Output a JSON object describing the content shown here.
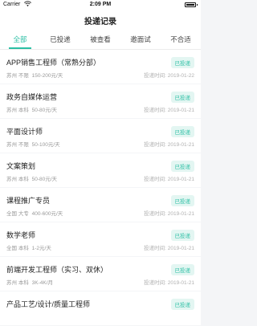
{
  "status_bar": {
    "carrier": "Carrier",
    "time": "2:09 PM"
  },
  "nav": {
    "title": "投递记录"
  },
  "tabs": [
    {
      "label": "全部"
    },
    {
      "label": "已投递"
    },
    {
      "label": "被查看"
    },
    {
      "label": "邀面试"
    },
    {
      "label": "不合适"
    }
  ],
  "active_tab": "全部",
  "accent_color": "#2bbfa4",
  "records": [
    {
      "title": "APP销售工程师（常熟分部）",
      "location": "苏州",
      "edu": "不限",
      "salary": "150-200元/天",
      "status": "已投递",
      "time": "投递时间: 2019-01-22"
    },
    {
      "title": "政务自媒体运营",
      "location": "苏州",
      "edu": "本科",
      "salary": "50-80元/天",
      "status": "已投递",
      "time": "投递时间: 2019-01-21"
    },
    {
      "title": "平面设计师",
      "location": "苏州",
      "edu": "不限",
      "salary": "50-100元/天",
      "status": "已投递",
      "time": "投递时间: 2019-01-21"
    },
    {
      "title": "文案策划",
      "location": "苏州",
      "edu": "本科",
      "salary": "50-80元/天",
      "status": "已投递",
      "time": "投递时间: 2019-01-21"
    },
    {
      "title": "课程推广专员",
      "location": "全国",
      "edu": "大专",
      "salary": "400-600元/天",
      "status": "已投递",
      "time": "投递时间: 2019-01-21"
    },
    {
      "title": "数学老师",
      "location": "全国",
      "edu": "本科",
      "salary": "1-2元/天",
      "status": "已投递",
      "time": "投递时间: 2019-01-21"
    },
    {
      "title": "前端开发工程师（实习、双休）",
      "location": "苏州",
      "edu": "本科",
      "salary": "3K-4K/月",
      "status": "已投递",
      "time": "投递时间: 2019-01-21"
    },
    {
      "title": "产品工艺/设计/质量工程师",
      "location": "",
      "edu": "",
      "salary": "",
      "status": "已投递",
      "time": ""
    }
  ]
}
